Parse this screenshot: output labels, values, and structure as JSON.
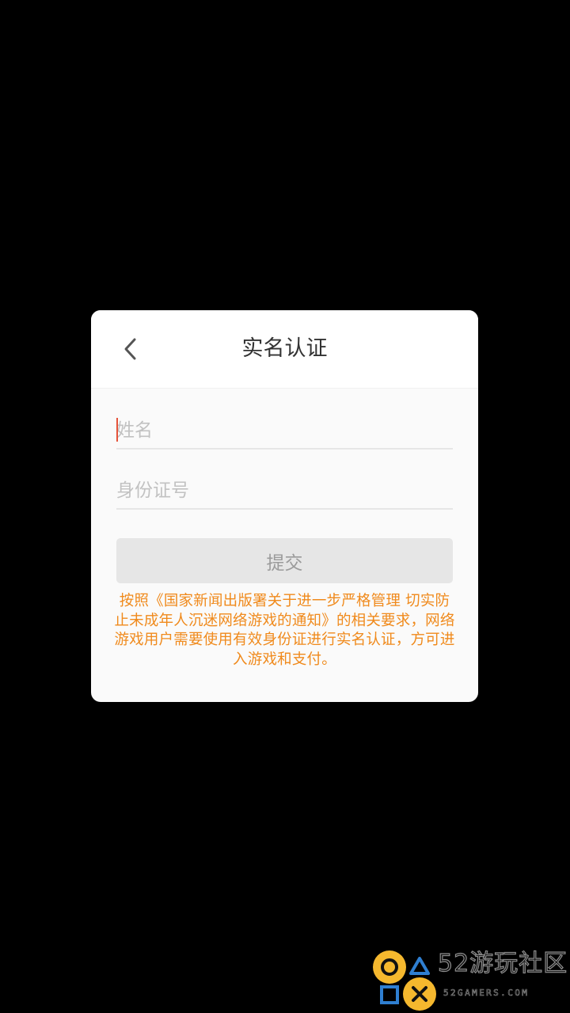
{
  "dialog": {
    "title": "实名认证",
    "back_icon": "chevron-left-icon",
    "name_field": {
      "placeholder": "姓名",
      "value": ""
    },
    "id_field": {
      "placeholder": "身份证号",
      "value": ""
    },
    "submit_label": "提交",
    "notice": "按照《国家新闻出版署关于进一步严格管理 切实防止未成年人沉迷网络游戏的通知》的相关要求，网络游戏用户需要使用有效身份证进行实名认证，方可进入游戏和支付。"
  },
  "watermark": {
    "logo": "gamepad-buttons-logo",
    "title": "52游玩社区",
    "subtitle": "52GAMERS.COM"
  },
  "colors": {
    "background": "#000000",
    "dialog_bg": "#fafafa",
    "notice_text": "#f08a1c",
    "cursor": "#e5533a",
    "button_disabled_bg": "#e6e6e6",
    "logo_accent": "#f5b82e",
    "logo_blue": "#2f7fd1"
  }
}
